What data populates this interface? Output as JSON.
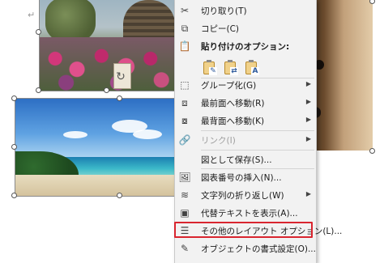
{
  "document": {
    "paragraph_mark": "↵"
  },
  "context_menu": {
    "items": [
      {
        "id": "cut",
        "label": "切り取り(T)",
        "icon": "scissors-icon"
      },
      {
        "id": "copy",
        "label": "コピー(C)",
        "icon": "copy-icon"
      },
      {
        "id": "paste_options",
        "label": "貼り付けのオプション:",
        "icon": "paste-icon"
      },
      {
        "id": "group",
        "label": "グループ化(G)",
        "icon": "group-icon",
        "submenu": true
      },
      {
        "id": "bring_front",
        "label": "最前面へ移動(R)",
        "icon": "bring-front-icon",
        "submenu": true
      },
      {
        "id": "send_back",
        "label": "最背面へ移動(K)",
        "icon": "send-back-icon",
        "submenu": true
      },
      {
        "id": "link",
        "label": "リンク(I)",
        "icon": "link-icon",
        "submenu": true,
        "disabled": true
      },
      {
        "id": "save_picture",
        "label": "図として保存(S)...",
        "icon": ""
      },
      {
        "id": "insert_caption",
        "label": "図表番号の挿入(N)...",
        "icon": "caption-icon"
      },
      {
        "id": "wrap_text",
        "label": "文字列の折り返し(W)",
        "icon": "wrap-text-icon",
        "submenu": true
      },
      {
        "id": "alt_text",
        "label": "代替テキストを表示(A)...",
        "icon": "alt-text-icon"
      },
      {
        "id": "more_layout",
        "label": "その他のレイアウト オプション(L)...",
        "icon": "layout-options-icon",
        "highlighted": true
      },
      {
        "id": "format_object",
        "label": "オブジェクトの書式設定(O)...",
        "icon": "format-object-icon"
      }
    ],
    "paste_buttons": [
      {
        "id": "keep_source",
        "mark": "✎"
      },
      {
        "id": "merge",
        "mark": "⇄"
      },
      {
        "id": "text_only",
        "mark": "A"
      }
    ],
    "highlight_color": "#d9252f"
  }
}
